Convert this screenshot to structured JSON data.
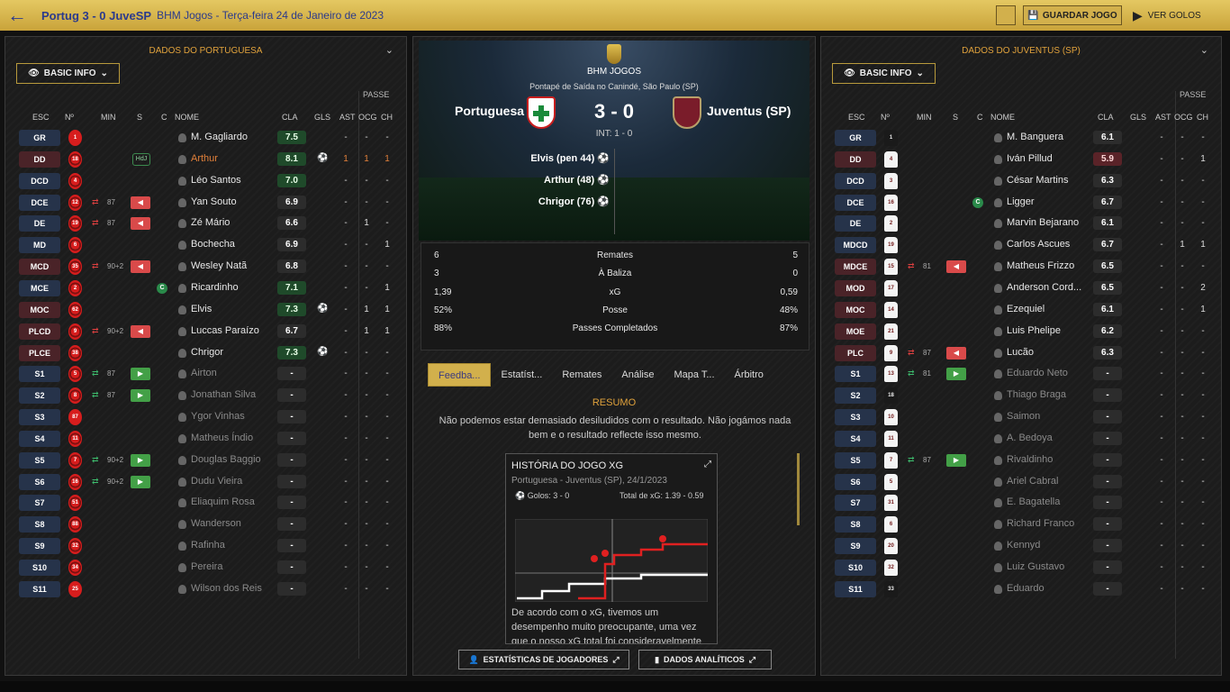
{
  "header": {
    "match_title": "Portug 3 - 0 JuveSP",
    "competition": "BHM Jogos - Terça-feira 24 de Janeiro de 2023",
    "save_label": "GUARDAR JOGO",
    "goals_label": "VER GOLOS"
  },
  "left": {
    "title": "DADOS DO PORTUGUESA",
    "info_label": "BASIC INFO",
    "passe_label": "PASSE",
    "cols": {
      "esc": "ESC",
      "no": "Nº",
      "min": "MIN",
      "s": "S",
      "c": "C",
      "nome": "NOME",
      "cla": "CLA",
      "gls": "GLS",
      "ast": "AST",
      "ocg": "OCG",
      "ch": "CH"
    },
    "players": [
      {
        "pos": "GR",
        "no": "1",
        "name": "M. Gagliardo",
        "cla": "7.5",
        "ast": "-",
        "ocg": "-",
        "ch": "-"
      },
      {
        "pos": "DD",
        "no": "18",
        "name": "Arthur",
        "cla": "8.1",
        "ast": "1",
        "ocg": "1",
        "ch": "1",
        "hdj": "HdJ"
      },
      {
        "pos": "DCD",
        "no": "4",
        "name": "Léo Santos",
        "cla": "7.0",
        "ast": "-",
        "ocg": "-",
        "ch": "-"
      },
      {
        "pos": "DCE",
        "no": "12",
        "name": "Yan Souto",
        "cla": "6.9",
        "ast": "-",
        "ocg": "-",
        "ch": "-",
        "min": "87",
        "out": true
      },
      {
        "pos": "DE",
        "no": "19",
        "name": "Zé Mário",
        "cla": "6.6",
        "ast": "-",
        "ocg": "1",
        "ch": "-",
        "min": "87",
        "out": true
      },
      {
        "pos": "MD",
        "no": "6",
        "name": "Bochecha",
        "cla": "6.9",
        "ast": "-",
        "ocg": "-",
        "ch": "1"
      },
      {
        "pos": "MCD",
        "no": "35",
        "name": "Wesley Natã",
        "cla": "6.8",
        "ast": "-",
        "ocg": "-",
        "ch": "-",
        "min": "90+2",
        "out": true
      },
      {
        "pos": "MCE",
        "no": "2",
        "name": "Ricardinho",
        "cla": "7.1",
        "ast": "-",
        "ocg": "-",
        "ch": "1",
        "card": "C"
      },
      {
        "pos": "MOC",
        "no": "62",
        "name": "Elvis",
        "cla": "7.3",
        "ast": "-",
        "ocg": "1",
        "ch": "1"
      },
      {
        "pos": "PLCD",
        "no": "9",
        "name": "Luccas Paraízo",
        "cla": "6.7",
        "ast": "-",
        "ocg": "1",
        "ch": "1",
        "min": "90+2",
        "out": true
      },
      {
        "pos": "PLCE",
        "no": "38",
        "name": "Chrigor",
        "cla": "7.3",
        "ast": "-",
        "ocg": "-",
        "ch": "-"
      },
      {
        "pos": "S1",
        "no": "5",
        "name": "Airton",
        "cla": "-",
        "ast": "-",
        "ocg": "-",
        "ch": "-",
        "min": "87",
        "in": true
      },
      {
        "pos": "S2",
        "no": "8",
        "name": "Jonathan Silva",
        "cla": "-",
        "ast": "-",
        "ocg": "-",
        "ch": "-",
        "min": "87",
        "in": true
      },
      {
        "pos": "S3",
        "no": "87",
        "name": "Ygor Vinhas",
        "cla": "-",
        "ast": "-",
        "ocg": "-",
        "ch": "-"
      },
      {
        "pos": "S4",
        "no": "11",
        "name": "Matheus Índio",
        "cla": "-",
        "ast": "-",
        "ocg": "-",
        "ch": "-"
      },
      {
        "pos": "S5",
        "no": "7",
        "name": "Douglas Baggio",
        "cla": "-",
        "ast": "-",
        "ocg": "-",
        "ch": "-",
        "min": "90+2",
        "in": true
      },
      {
        "pos": "S6",
        "no": "16",
        "name": "Dudu Vieira",
        "cla": "-",
        "ast": "-",
        "ocg": "-",
        "ch": "-",
        "min": "90+2",
        "in": true
      },
      {
        "pos": "S7",
        "no": "51",
        "name": "Eliaquim Rosa",
        "cla": "-",
        "ast": "-",
        "ocg": "-",
        "ch": "-"
      },
      {
        "pos": "S8",
        "no": "88",
        "name": "Wanderson",
        "cla": "-",
        "ast": "-",
        "ocg": "-",
        "ch": "-"
      },
      {
        "pos": "S9",
        "no": "32",
        "name": "Rafinha",
        "cla": "-",
        "ast": "-",
        "ocg": "-",
        "ch": "-"
      },
      {
        "pos": "S10",
        "no": "34",
        "name": "Pereira",
        "cla": "-",
        "ast": "-",
        "ocg": "-",
        "ch": "-"
      },
      {
        "pos": "S11",
        "no": "25",
        "name": "Wilson dos Reis",
        "cla": "-",
        "ast": "-",
        "ocg": "-",
        "ch": "-"
      }
    ]
  },
  "center": {
    "competition": "BHM JOGOS",
    "venue": "Pontapé de Saída no Canindé, São Paulo (SP)",
    "home": "Portuguesa",
    "away": "Juventus (SP)",
    "score": "3 - 0",
    "ht": "INT: 1 - 0",
    "scorers": [
      "Elvis (pen 44)",
      "Arthur (48)",
      "Chrigor (76)"
    ],
    "stats": [
      {
        "a": "6",
        "label": "Remates",
        "b": "5"
      },
      {
        "a": "3",
        "label": "À Baliza",
        "b": "0"
      },
      {
        "a": "1,39",
        "label": "xG",
        "b": "0,59"
      },
      {
        "a": "52%",
        "label": "Posse",
        "b": "48%"
      },
      {
        "a": "88%",
        "label": "Passes Completados",
        "b": "87%"
      }
    ],
    "tabs": [
      "Feedba...",
      "Estatíst...",
      "Remates",
      "Análise",
      "Mapa T...",
      "Árbitro"
    ],
    "resumo_title": "RESUMO",
    "resumo_text": "Não podemos estar demasiado desiludidos com o resultado. Não jogámos nada bem e o resultado reflecte isso mesmo.",
    "xg": {
      "title": "HISTÓRIA DO JOGO XG",
      "date": "Portuguesa - Juventus (SP), 24/1/2023",
      "goals": "Golos: 3 - 0",
      "total": "Total de xG: 1.39 - 0.59",
      "text": "De acordo com o xG, tivemos um desempenho muito preocupante, uma vez que o nosso xG total foi consideravelmente"
    },
    "btn_players": "ESTATÍSTICAS DE JOGADORES",
    "btn_analytics": "DADOS ANALÍTICOS"
  },
  "right": {
    "title": "DADOS DO JUVENTUS (SP)",
    "info_label": "BASIC INFO",
    "passe_label": "PASSE",
    "players": [
      {
        "pos": "GR",
        "no": "1",
        "name": "M. Banguera",
        "cla": "6.1",
        "ast": "-",
        "ocg": "-",
        "ch": "-"
      },
      {
        "pos": "DD",
        "no": "4",
        "name": "Iván Pillud",
        "cla": "5.9",
        "ast": "-",
        "ocg": "-",
        "ch": "1"
      },
      {
        "pos": "DCD",
        "no": "3",
        "name": "César Martins",
        "cla": "6.3",
        "ast": "-",
        "ocg": "-",
        "ch": "-"
      },
      {
        "pos": "DCE",
        "no": "16",
        "name": "Ligger",
        "cla": "6.7",
        "ast": "-",
        "ocg": "-",
        "ch": "-",
        "card": "C"
      },
      {
        "pos": "DE",
        "no": "2",
        "name": "Marvin Bejarano",
        "cla": "6.1",
        "ast": "-",
        "ocg": "-",
        "ch": "-"
      },
      {
        "pos": "MDCD",
        "no": "19",
        "name": "Carlos Ascues",
        "cla": "6.7",
        "ast": "-",
        "ocg": "1",
        "ch": "1"
      },
      {
        "pos": "MDCE",
        "no": "15",
        "name": "Matheus Frizzo",
        "cla": "6.5",
        "ast": "-",
        "ocg": "-",
        "ch": "-",
        "min": "81",
        "out": true
      },
      {
        "pos": "MOD",
        "no": "17",
        "name": "Anderson Cord...",
        "cla": "6.5",
        "ast": "-",
        "ocg": "-",
        "ch": "2"
      },
      {
        "pos": "MOC",
        "no": "14",
        "name": "Ezequiel",
        "cla": "6.1",
        "ast": "-",
        "ocg": "-",
        "ch": "1"
      },
      {
        "pos": "MOE",
        "no": "21",
        "name": "Luis Phelipe",
        "cla": "6.2",
        "ast": "-",
        "ocg": "-",
        "ch": "-"
      },
      {
        "pos": "PLC",
        "no": "9",
        "name": "Lucão",
        "cla": "6.3",
        "ast": "-",
        "ocg": "-",
        "ch": "-",
        "min": "87",
        "out": true
      },
      {
        "pos": "S1",
        "no": "13",
        "name": "Eduardo Neto",
        "cla": "-",
        "ast": "-",
        "ocg": "-",
        "ch": "-",
        "min": "81",
        "in": true
      },
      {
        "pos": "S2",
        "no": "18",
        "name": "Thiago Braga",
        "cla": "-",
        "ast": "-",
        "ocg": "-",
        "ch": "-"
      },
      {
        "pos": "S3",
        "no": "10",
        "name": "Saimon",
        "cla": "-",
        "ast": "-",
        "ocg": "-",
        "ch": "-"
      },
      {
        "pos": "S4",
        "no": "11",
        "name": "A. Bedoya",
        "cla": "-",
        "ast": "-",
        "ocg": "-",
        "ch": "-"
      },
      {
        "pos": "S5",
        "no": "7",
        "name": "Rivaldinho",
        "cla": "-",
        "ast": "-",
        "ocg": "-",
        "ch": "-",
        "min": "87",
        "in": true
      },
      {
        "pos": "S6",
        "no": "5",
        "name": "Ariel Cabral",
        "cla": "-",
        "ast": "-",
        "ocg": "-",
        "ch": "-"
      },
      {
        "pos": "S7",
        "no": "31",
        "name": "E. Bagatella",
        "cla": "-",
        "ast": "-",
        "ocg": "-",
        "ch": "-"
      },
      {
        "pos": "S8",
        "no": "6",
        "name": "Richard Franco",
        "cla": "-",
        "ast": "-",
        "ocg": "-",
        "ch": "-"
      },
      {
        "pos": "S9",
        "no": "20",
        "name": "Kennyd",
        "cla": "-",
        "ast": "-",
        "ocg": "-",
        "ch": "-"
      },
      {
        "pos": "S10",
        "no": "32",
        "name": "Luiz Gustavo",
        "cla": "-",
        "ast": "-",
        "ocg": "-",
        "ch": "-"
      },
      {
        "pos": "S11",
        "no": "33",
        "name": "Eduardo",
        "cla": "-",
        "ast": "-",
        "ocg": "-",
        "ch": "-"
      }
    ]
  }
}
